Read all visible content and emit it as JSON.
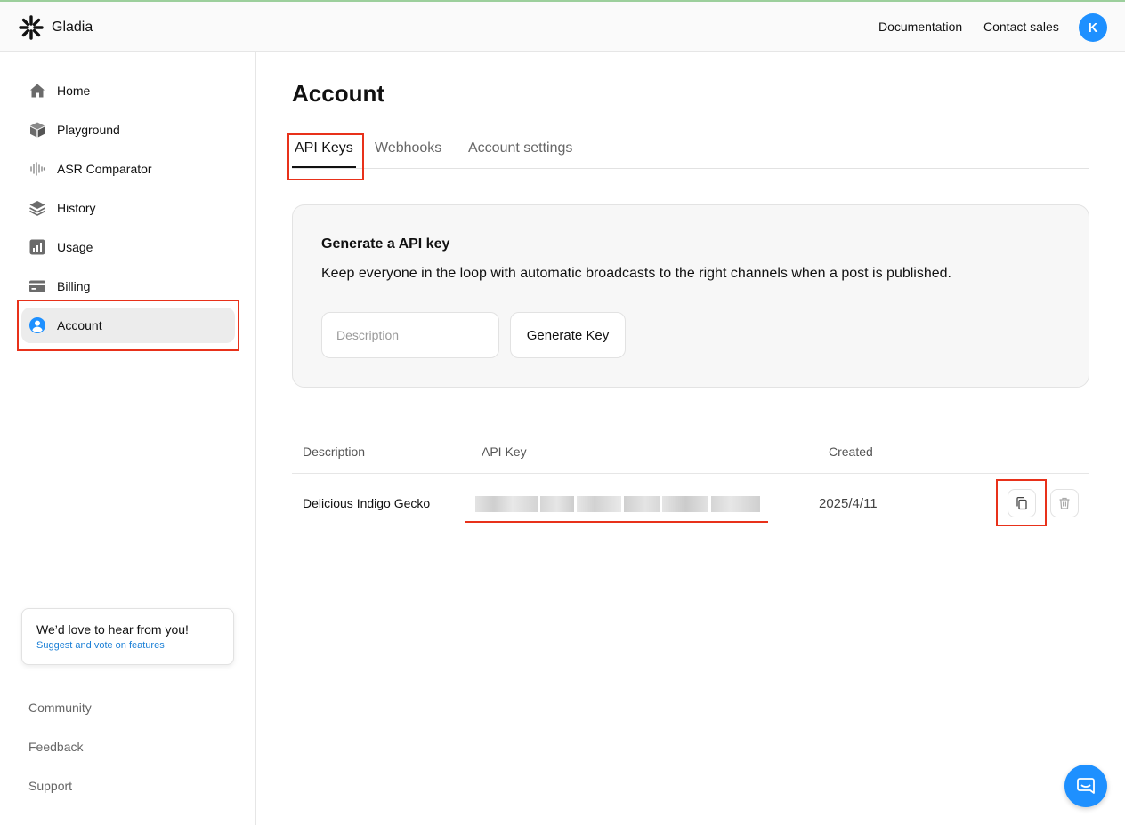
{
  "header": {
    "brand": "Gladia",
    "links": [
      {
        "label": "Documentation"
      },
      {
        "label": "Contact sales"
      }
    ],
    "avatar_initial": "K",
    "avatar_color": "#1e90ff"
  },
  "sidebar": {
    "items": [
      {
        "label": "Home",
        "icon": "home-icon"
      },
      {
        "label": "Playground",
        "icon": "cube-icon"
      },
      {
        "label": "ASR Comparator",
        "icon": "waveform-icon"
      },
      {
        "label": "History",
        "icon": "layers-icon"
      },
      {
        "label": "Usage",
        "icon": "bar-chart-icon"
      },
      {
        "label": "Billing",
        "icon": "credit-card-icon"
      },
      {
        "label": "Account",
        "icon": "user-circle-icon",
        "active": true
      }
    ],
    "feedback": {
      "title": "We’d love to hear from you!",
      "link": "Suggest and vote on features"
    },
    "bottom_links": [
      {
        "label": "Community"
      },
      {
        "label": "Feedback"
      },
      {
        "label": "Support"
      }
    ]
  },
  "main": {
    "title": "Account",
    "tabs": [
      {
        "label": "API Keys",
        "active": true
      },
      {
        "label": "Webhooks"
      },
      {
        "label": "Account settings"
      }
    ],
    "generate": {
      "title": "Generate a API key",
      "description": "Keep everyone in the loop with automatic broadcasts to the right channels when a post is published.",
      "input_placeholder": "Description",
      "input_value": "",
      "button_label": "Generate Key"
    },
    "table": {
      "headers": [
        "Description",
        "API Key",
        "Created"
      ],
      "rows": [
        {
          "description": "Delicious Indigo Gecko",
          "api_key": "[redacted]",
          "created": "2025/4/11"
        }
      ]
    }
  },
  "colors": {
    "accent": "#1e90ff",
    "highlight": "#e8311a"
  }
}
